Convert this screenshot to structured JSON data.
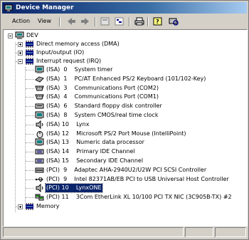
{
  "window": {
    "title": "Device Manager"
  },
  "menu": {
    "action": "Action",
    "view": "View"
  },
  "toolbar": {
    "buttons": [
      "back-icon",
      "forward-icon",
      "properties-icon",
      "tree-view-icon",
      "print-icon",
      "help-icon",
      "scan-icon"
    ]
  },
  "tree": {
    "root": "DEV",
    "dma": "Direct memory access (DMA)",
    "io": "Input/output (IO)",
    "irq": "Interrupt request (IRQ)",
    "memory": "Memory",
    "irq_items": [
      {
        "text": "(ISA)  0    System timer",
        "icon": "timer"
      },
      {
        "text": "(ISA)  1    PC/AT Enhanced PS/2 Keyboard (101/102-Key)",
        "icon": "keyboard"
      },
      {
        "text": "(ISA)  3    Communications Port (COM2)",
        "icon": "port"
      },
      {
        "text": "(ISA)  4    Communications Port (COM1)",
        "icon": "port"
      },
      {
        "text": "(ISA)  6    Standard floppy disk controller",
        "icon": "floppy"
      },
      {
        "text": "(ISA)  8    System CMOS/real time clock",
        "icon": "computer"
      },
      {
        "text": "(ISA) 10    Lynx",
        "icon": "sound"
      },
      {
        "text": "(ISA) 12    Microsoft PS/2 Port Mouse (IntelliPoint)",
        "icon": "mouse"
      },
      {
        "text": "(ISA) 13    Numeric data processor",
        "icon": "computer"
      },
      {
        "text": "(ISA) 14    Primary IDE Channel",
        "icon": "ide"
      },
      {
        "text": "(ISA) 15    Secondary IDE Channel",
        "icon": "ide"
      },
      {
        "text": "(PCI)  9    Adaptec AHA-2940U2/U2W PCI SCSI Controller",
        "icon": "scsi"
      },
      {
        "text": "(PCI)  9    Intel 82371AB/EB PCI to USB Universal Host Controller",
        "icon": "usb"
      },
      {
        "text": "(PCI) 10    LynxONE",
        "icon": "sound"
      },
      {
        "text": "(PCI) 11    3Com EtherLink XL 10/100 PCI TX NIC (3C905B-TX) #2",
        "icon": "network"
      }
    ]
  },
  "colors": {
    "title": "#0a246a",
    "selection": "#0a246a",
    "face": "#d4d0c8"
  }
}
